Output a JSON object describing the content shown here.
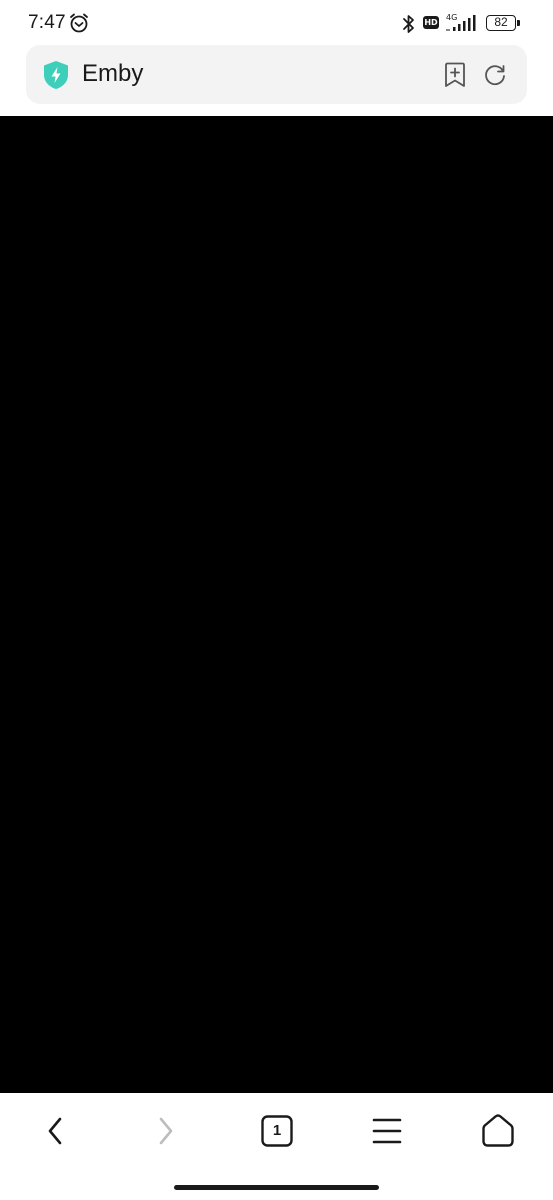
{
  "status_bar": {
    "time": "7:47",
    "network": "4G",
    "battery": "82",
    "icons": [
      "alarm-icon",
      "bluetooth-icon",
      "hd-icon",
      "signal-icon",
      "battery-icon"
    ]
  },
  "address_bar": {
    "title": "Emby",
    "icons": [
      "shield-icon",
      "bookmark-add-icon",
      "refresh-icon"
    ],
    "shield_color": "#3dcfb9"
  },
  "content": {
    "background": "#000000"
  },
  "bottom_nav": {
    "tab_count": "1",
    "icons": [
      "back-icon",
      "forward-icon",
      "tabs-icon",
      "menu-icon",
      "home-icon"
    ]
  }
}
